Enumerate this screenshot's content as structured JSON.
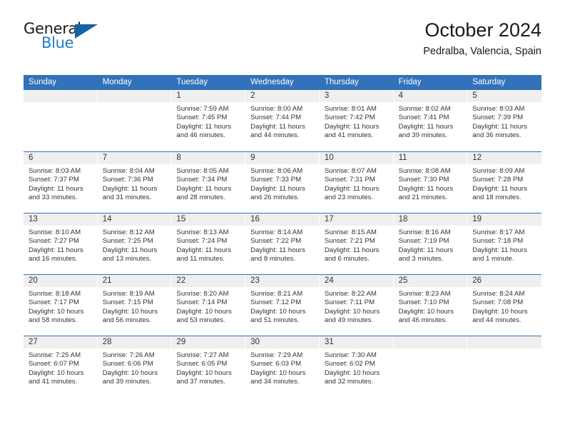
{
  "logo": {
    "word_one": "General",
    "word_two": "Blue",
    "shape": "triangle"
  },
  "header": {
    "title": "October 2024",
    "subtitle": "Pedralba, Valencia, Spain"
  },
  "colors": {
    "header_blue": "#3172b9",
    "row_border_blue": "#3172b9",
    "day_band_gray": "#efefef",
    "logo_blue": "#1f7fc4",
    "text": "#333333"
  },
  "calendar": {
    "weekdays": [
      "Sunday",
      "Monday",
      "Tuesday",
      "Wednesday",
      "Thursday",
      "Friday",
      "Saturday"
    ],
    "weeks": [
      [
        {
          "day": "",
          "sunrise": "",
          "sunset": "",
          "daylight_line1": "",
          "daylight_line2": ""
        },
        {
          "day": "",
          "sunrise": "",
          "sunset": "",
          "daylight_line1": "",
          "daylight_line2": ""
        },
        {
          "day": "1",
          "sunrise": "Sunrise: 7:59 AM",
          "sunset": "Sunset: 7:45 PM",
          "daylight_line1": "Daylight: 11 hours",
          "daylight_line2": "and 46 minutes."
        },
        {
          "day": "2",
          "sunrise": "Sunrise: 8:00 AM",
          "sunset": "Sunset: 7:44 PM",
          "daylight_line1": "Daylight: 11 hours",
          "daylight_line2": "and 44 minutes."
        },
        {
          "day": "3",
          "sunrise": "Sunrise: 8:01 AM",
          "sunset": "Sunset: 7:42 PM",
          "daylight_line1": "Daylight: 11 hours",
          "daylight_line2": "and 41 minutes."
        },
        {
          "day": "4",
          "sunrise": "Sunrise: 8:02 AM",
          "sunset": "Sunset: 7:41 PM",
          "daylight_line1": "Daylight: 11 hours",
          "daylight_line2": "and 39 minutes."
        },
        {
          "day": "5",
          "sunrise": "Sunrise: 8:03 AM",
          "sunset": "Sunset: 7:39 PM",
          "daylight_line1": "Daylight: 11 hours",
          "daylight_line2": "and 36 minutes."
        }
      ],
      [
        {
          "day": "6",
          "sunrise": "Sunrise: 8:03 AM",
          "sunset": "Sunset: 7:37 PM",
          "daylight_line1": "Daylight: 11 hours",
          "daylight_line2": "and 33 minutes."
        },
        {
          "day": "7",
          "sunrise": "Sunrise: 8:04 AM",
          "sunset": "Sunset: 7:36 PM",
          "daylight_line1": "Daylight: 11 hours",
          "daylight_line2": "and 31 minutes."
        },
        {
          "day": "8",
          "sunrise": "Sunrise: 8:05 AM",
          "sunset": "Sunset: 7:34 PM",
          "daylight_line1": "Daylight: 11 hours",
          "daylight_line2": "and 28 minutes."
        },
        {
          "day": "9",
          "sunrise": "Sunrise: 8:06 AM",
          "sunset": "Sunset: 7:33 PM",
          "daylight_line1": "Daylight: 11 hours",
          "daylight_line2": "and 26 minutes."
        },
        {
          "day": "10",
          "sunrise": "Sunrise: 8:07 AM",
          "sunset": "Sunset: 7:31 PM",
          "daylight_line1": "Daylight: 11 hours",
          "daylight_line2": "and 23 minutes."
        },
        {
          "day": "11",
          "sunrise": "Sunrise: 8:08 AM",
          "sunset": "Sunset: 7:30 PM",
          "daylight_line1": "Daylight: 11 hours",
          "daylight_line2": "and 21 minutes."
        },
        {
          "day": "12",
          "sunrise": "Sunrise: 8:09 AM",
          "sunset": "Sunset: 7:28 PM",
          "daylight_line1": "Daylight: 11 hours",
          "daylight_line2": "and 18 minutes."
        }
      ],
      [
        {
          "day": "13",
          "sunrise": "Sunrise: 8:10 AM",
          "sunset": "Sunset: 7:27 PM",
          "daylight_line1": "Daylight: 11 hours",
          "daylight_line2": "and 16 minutes."
        },
        {
          "day": "14",
          "sunrise": "Sunrise: 8:12 AM",
          "sunset": "Sunset: 7:25 PM",
          "daylight_line1": "Daylight: 11 hours",
          "daylight_line2": "and 13 minutes."
        },
        {
          "day": "15",
          "sunrise": "Sunrise: 8:13 AM",
          "sunset": "Sunset: 7:24 PM",
          "daylight_line1": "Daylight: 11 hours",
          "daylight_line2": "and 11 minutes."
        },
        {
          "day": "16",
          "sunrise": "Sunrise: 8:14 AM",
          "sunset": "Sunset: 7:22 PM",
          "daylight_line1": "Daylight: 11 hours",
          "daylight_line2": "and 8 minutes."
        },
        {
          "day": "17",
          "sunrise": "Sunrise: 8:15 AM",
          "sunset": "Sunset: 7:21 PM",
          "daylight_line1": "Daylight: 11 hours",
          "daylight_line2": "and 6 minutes."
        },
        {
          "day": "18",
          "sunrise": "Sunrise: 8:16 AM",
          "sunset": "Sunset: 7:19 PM",
          "daylight_line1": "Daylight: 11 hours",
          "daylight_line2": "and 3 minutes."
        },
        {
          "day": "19",
          "sunrise": "Sunrise: 8:17 AM",
          "sunset": "Sunset: 7:18 PM",
          "daylight_line1": "Daylight: 11 hours",
          "daylight_line2": "and 1 minute."
        }
      ],
      [
        {
          "day": "20",
          "sunrise": "Sunrise: 8:18 AM",
          "sunset": "Sunset: 7:17 PM",
          "daylight_line1": "Daylight: 10 hours",
          "daylight_line2": "and 58 minutes."
        },
        {
          "day": "21",
          "sunrise": "Sunrise: 8:19 AM",
          "sunset": "Sunset: 7:15 PM",
          "daylight_line1": "Daylight: 10 hours",
          "daylight_line2": "and 56 minutes."
        },
        {
          "day": "22",
          "sunrise": "Sunrise: 8:20 AM",
          "sunset": "Sunset: 7:14 PM",
          "daylight_line1": "Daylight: 10 hours",
          "daylight_line2": "and 53 minutes."
        },
        {
          "day": "23",
          "sunrise": "Sunrise: 8:21 AM",
          "sunset": "Sunset: 7:12 PM",
          "daylight_line1": "Daylight: 10 hours",
          "daylight_line2": "and 51 minutes."
        },
        {
          "day": "24",
          "sunrise": "Sunrise: 8:22 AM",
          "sunset": "Sunset: 7:11 PM",
          "daylight_line1": "Daylight: 10 hours",
          "daylight_line2": "and 49 minutes."
        },
        {
          "day": "25",
          "sunrise": "Sunrise: 8:23 AM",
          "sunset": "Sunset: 7:10 PM",
          "daylight_line1": "Daylight: 10 hours",
          "daylight_line2": "and 46 minutes."
        },
        {
          "day": "26",
          "sunrise": "Sunrise: 8:24 AM",
          "sunset": "Sunset: 7:08 PM",
          "daylight_line1": "Daylight: 10 hours",
          "daylight_line2": "and 44 minutes."
        }
      ],
      [
        {
          "day": "27",
          "sunrise": "Sunrise: 7:25 AM",
          "sunset": "Sunset: 6:07 PM",
          "daylight_line1": "Daylight: 10 hours",
          "daylight_line2": "and 41 minutes."
        },
        {
          "day": "28",
          "sunrise": "Sunrise: 7:26 AM",
          "sunset": "Sunset: 6:06 PM",
          "daylight_line1": "Daylight: 10 hours",
          "daylight_line2": "and 39 minutes."
        },
        {
          "day": "29",
          "sunrise": "Sunrise: 7:27 AM",
          "sunset": "Sunset: 6:05 PM",
          "daylight_line1": "Daylight: 10 hours",
          "daylight_line2": "and 37 minutes."
        },
        {
          "day": "30",
          "sunrise": "Sunrise: 7:29 AM",
          "sunset": "Sunset: 6:03 PM",
          "daylight_line1": "Daylight: 10 hours",
          "daylight_line2": "and 34 minutes."
        },
        {
          "day": "31",
          "sunrise": "Sunrise: 7:30 AM",
          "sunset": "Sunset: 6:02 PM",
          "daylight_line1": "Daylight: 10 hours",
          "daylight_line2": "and 32 minutes."
        },
        {
          "day": "",
          "sunrise": "",
          "sunset": "",
          "daylight_line1": "",
          "daylight_line2": ""
        },
        {
          "day": "",
          "sunrise": "",
          "sunset": "",
          "daylight_line1": "",
          "daylight_line2": ""
        }
      ]
    ]
  }
}
